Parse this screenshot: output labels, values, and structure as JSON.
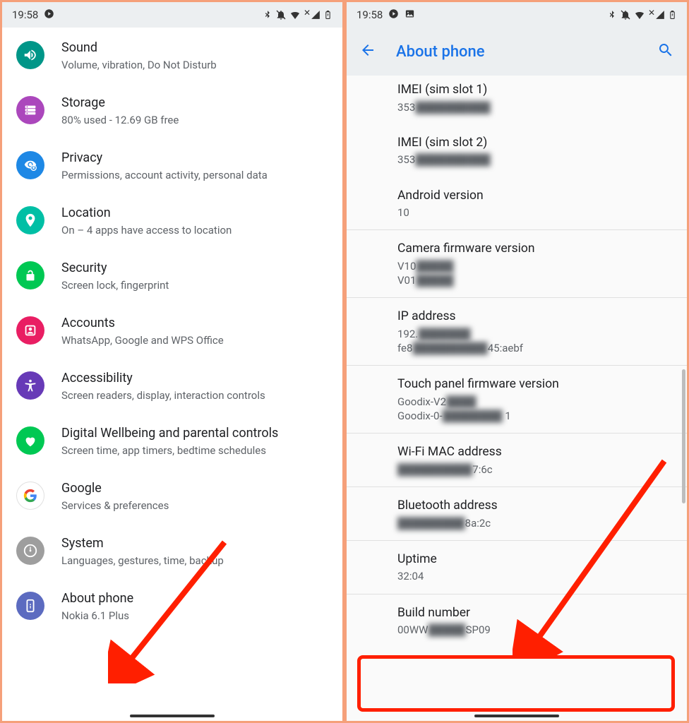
{
  "status": {
    "time": "19:58",
    "icons_left": [
      "play",
      "image"
    ],
    "icons_right": "✱ 🔕 ▾ ✕◢ 🔋"
  },
  "left": {
    "items": [
      {
        "key": "sound",
        "title": "Sound",
        "sub": "Volume, vibration, Do Not Disturb",
        "color": "#009688"
      },
      {
        "key": "storage",
        "title": "Storage",
        "sub": "80% used - 12.69 GB free",
        "color": "#ab47bc"
      },
      {
        "key": "privacy",
        "title": "Privacy",
        "sub": "Permissions, account activity, personal data",
        "color": "#1e88e5"
      },
      {
        "key": "location",
        "title": "Location",
        "sub": "On – 4 apps have access to location",
        "color": "#00bfa5"
      },
      {
        "key": "security",
        "title": "Security",
        "sub": "Screen lock, fingerprint",
        "color": "#00c853"
      },
      {
        "key": "accounts",
        "title": "Accounts",
        "sub": "WhatsApp, Google and WPS Office",
        "color": "#e91e63"
      },
      {
        "key": "accessibility",
        "title": "Accessibility",
        "sub": "Screen readers, display, interaction controls",
        "color": "#673ab7"
      },
      {
        "key": "wellbeing",
        "title": "Digital Wellbeing and parental controls",
        "sub": "Screen time, app timers, bedtime schedules",
        "color": "#00c853"
      },
      {
        "key": "google",
        "title": "Google",
        "sub": "Services & preferences",
        "color": "#ffffff"
      },
      {
        "key": "system",
        "title": "System",
        "sub": "Languages, gestures, time, backup",
        "color": "#9e9e9e"
      },
      {
        "key": "about",
        "title": "About phone",
        "sub": "Nokia 6.1 Plus",
        "color": "#5c6bc0"
      }
    ]
  },
  "right": {
    "title": "About phone",
    "items": [
      {
        "key": "imei1",
        "title": "IMEI (sim slot 1)",
        "sub": "353",
        "blur": true
      },
      {
        "key": "imei2",
        "title": "IMEI (sim slot 2)",
        "sub": "353",
        "blur": true
      },
      {
        "key": "android",
        "title": "Android version",
        "sub": "10"
      },
      {
        "key": "camera",
        "title": "Camera firmware version",
        "sub": "V10\nV01",
        "blur": true
      },
      {
        "key": "ip",
        "title": "IP address",
        "sub": "192.\nfe80                    45:aebf",
        "blur": true
      },
      {
        "key": "touch",
        "title": "Touch panel firmware version",
        "sub": "Goodix-V2\nGoodix-0-V              1",
        "blur": true
      },
      {
        "key": "wifimac",
        "title": "Wi-Fi MAC address",
        "sub": "              7:6c",
        "blur": true
      },
      {
        "key": "bt",
        "title": "Bluetooth address",
        "sub": "              8a:2c",
        "blur": true
      },
      {
        "key": "uptime",
        "title": "Uptime",
        "sub": "32:04"
      },
      {
        "key": "build",
        "title": "Build number",
        "sub": "00WW        SP09",
        "blur": true
      }
    ]
  }
}
